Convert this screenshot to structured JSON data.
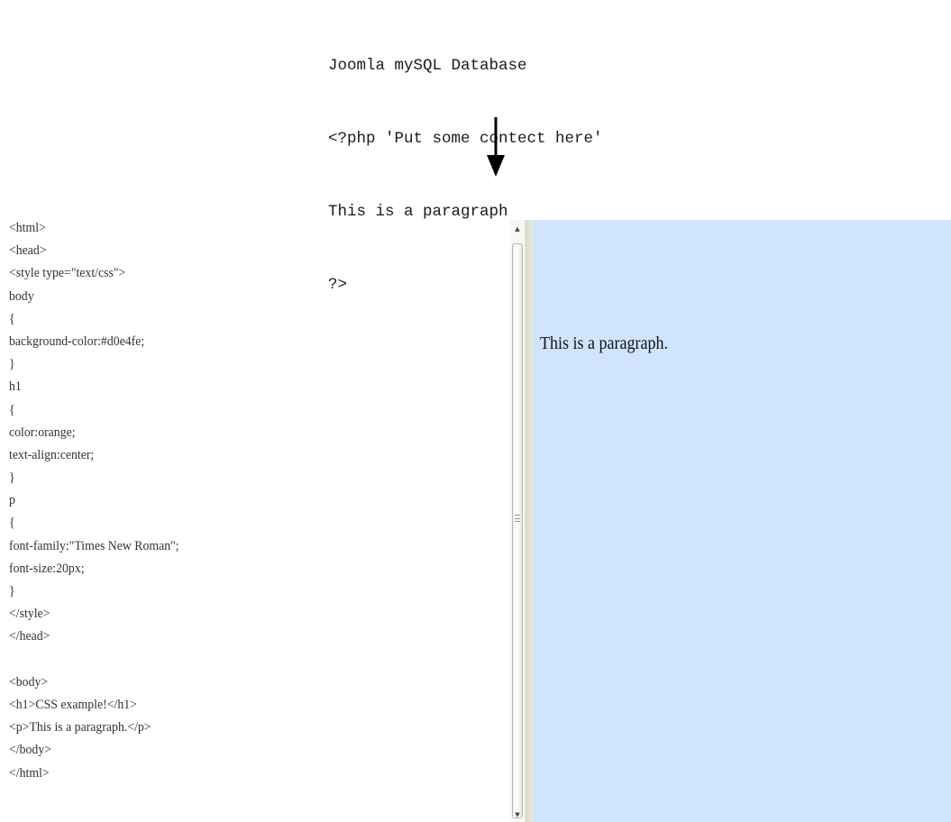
{
  "top_snippet": {
    "lines": [
      "Joomla mySQL Database",
      "<?php 'Put some contect here'",
      "This is a paragraph",
      "?>"
    ]
  },
  "arrow": {
    "icon": "down-arrow-icon"
  },
  "code_listing": {
    "lines": [
      "<html>",
      "<head>",
      "<style type=\"text/css\">",
      "body",
      "{",
      "background-color:#d0e4fe;",
      "}",
      "h1",
      "{",
      "color:orange;",
      "text-align:center;",
      "}",
      "p",
      "{",
      "font-family:\"Times New Roman\";",
      "font-size:20px;",
      "}",
      "</style>",
      "</head>",
      "",
      "<body>",
      "<h1>CSS example!</h1>",
      "<p>This is a paragraph.</p>",
      "</body>",
      "</html>"
    ]
  },
  "preview": {
    "background_color": "#d0e4fe",
    "paragraph": "This is a paragraph.",
    "scrollbar": {
      "up_icon": "scroll-up-arrow-icon",
      "down_icon": "scroll-down-arrow-icon",
      "grip_icon": "scroll-grip-icon"
    }
  }
}
